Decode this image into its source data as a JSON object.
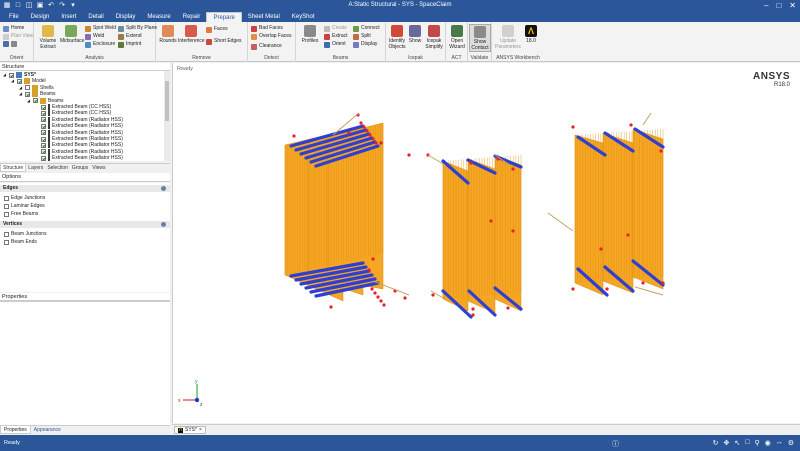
{
  "window": {
    "title": "A:Static Structural - SYS - SpaceClaim"
  },
  "menu": {
    "tabs": [
      {
        "label": "File"
      },
      {
        "label": "Design"
      },
      {
        "label": "Insert"
      },
      {
        "label": "Detail"
      },
      {
        "label": "Display"
      },
      {
        "label": "Measure"
      },
      {
        "label": "Repair"
      },
      {
        "label": "Prepare"
      },
      {
        "label": "Sheet Metal"
      },
      {
        "label": "KeyShot"
      }
    ],
    "active_index": 7
  },
  "ribbon": {
    "orient": {
      "label": "Orient",
      "home": "Home",
      "plan_view": "Plan View"
    },
    "analysis": {
      "label": "Analysis",
      "volume_extract": "Volume\nExtract",
      "midsurface": "Midsurface",
      "spot_weld": "Spot Weld",
      "weld": "Weld",
      "enclosure": "Enclosure",
      "split_by_plane": "Split By Plane",
      "extend": "Extend",
      "imprint": "Imprint"
    },
    "remove": {
      "label": "Remove",
      "rounds": "Rounds",
      "interference": "Interference",
      "faces": "Faces",
      "short_edges": "Short Edges"
    },
    "detect": {
      "label": "Detect",
      "bad_faces": "Bad Faces",
      "overlap_faces": "Overlap Faces",
      "clearance": "Clearance"
    },
    "beams": {
      "label": "Beams",
      "profiles": "Profiles",
      "create": "Create",
      "extract": "Extract",
      "orient": "Orient",
      "connect": "Connect",
      "split": "Split",
      "display": "Display"
    },
    "icepak": {
      "label": "Icepak",
      "identify_objects": "Identify\nObjects",
      "show": "Show",
      "icepak_simplify": "Icepak\nSimplify"
    },
    "act": {
      "label": "ACT",
      "open_wizard": "Open\nWizard"
    },
    "validate": {
      "label": "Validate",
      "show_contact": "Show\nContact"
    },
    "workbench": {
      "label": "ANSYS Workbench",
      "update_parameters": "Update\nParameters",
      "version": "18.0"
    }
  },
  "structure": {
    "title": "Structure",
    "tree": [
      {
        "label": "SYS*",
        "level": 0,
        "checked": true,
        "bold": true
      },
      {
        "label": "Model",
        "level": 1,
        "checked": true
      },
      {
        "label": "Shells",
        "level": 2,
        "checked": false
      },
      {
        "label": "Beams",
        "level": 2,
        "checked": true
      },
      {
        "label": "Beams",
        "level": 3,
        "checked": true
      },
      {
        "label": "Extracted Beam (CC HSS)",
        "level": 4,
        "checked": true
      },
      {
        "label": "Extracted Beam (CC HSS)",
        "level": 4,
        "checked": true
      },
      {
        "label": "Extracted Beam (Radiator HSS)",
        "level": 4,
        "checked": true
      },
      {
        "label": "Extracted Beam (Radiator HSS)",
        "level": 4,
        "checked": true
      },
      {
        "label": "Extracted Beam (Radiator HSS)",
        "level": 4,
        "checked": true
      },
      {
        "label": "Extracted Beam (Radiator HSS)",
        "level": 4,
        "checked": true
      },
      {
        "label": "Extracted Beam (Radiator HSS)",
        "level": 4,
        "checked": true
      },
      {
        "label": "Extracted Beam (Radiator HSS)",
        "level": 4,
        "checked": true
      },
      {
        "label": "Extracted Beam (Radiator HSS)",
        "level": 4,
        "checked": true
      }
    ],
    "tabs": [
      "Structure",
      "Layers",
      "Selection",
      "Groups",
      "Views"
    ]
  },
  "options": {
    "title": "Options",
    "edges": {
      "header": "Edges",
      "items": [
        {
          "label": "Edge Junctions",
          "checked": true
        },
        {
          "label": "Laminar Edges",
          "checked": true
        },
        {
          "label": "Free Beams",
          "checked": true
        }
      ]
    },
    "vertices": {
      "header": "Vertices",
      "items": [
        {
          "label": "Beam Junctions",
          "checked": true
        },
        {
          "label": "Beam Ends",
          "checked": true
        }
      ]
    }
  },
  "properties": {
    "title": "Properties",
    "tabs": [
      "Properties",
      "Appearance"
    ]
  },
  "viewport": {
    "status": "Ready",
    "brand_name": "ANSYS",
    "brand_version": "R18.0",
    "doc_tab": "SYS*",
    "triad": {
      "x": "x",
      "y": "y",
      "z": "z"
    },
    "colors": {
      "plate": "#f5a623",
      "beam": "#2f3fd1",
      "node": "#e8202a"
    }
  },
  "statusbar": {
    "text": "Ready"
  }
}
